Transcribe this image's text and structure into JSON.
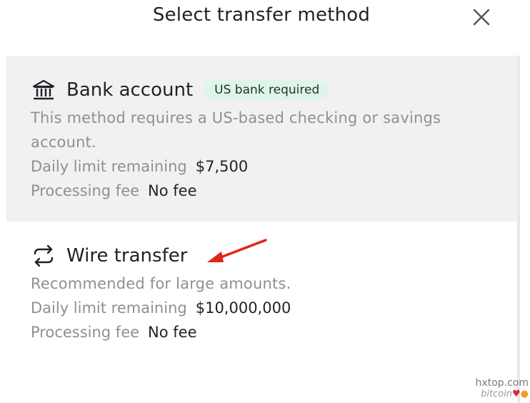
{
  "dialog": {
    "title": "Select transfer method",
    "close_icon": "close-icon"
  },
  "options": [
    {
      "id": "bank",
      "icon": "bank-icon",
      "label": "Bank account",
      "badge": "US bank required",
      "description": "This method requires a US-based checking or savings account.",
      "limit_label": "Daily limit remaining",
      "limit_value": "$7,500",
      "fee_label": "Processing fee",
      "fee_value": "No fee",
      "selected": true
    },
    {
      "id": "wire",
      "icon": "swap-arrows-icon",
      "label": "Wire transfer",
      "description": "Recommended for large amounts.",
      "limit_label": "Daily limit remaining",
      "limit_value": "$10,000,000",
      "fee_label": "Processing fee",
      "fee_value": "No fee",
      "selected": false
    }
  ],
  "annotation": {
    "icon": "red-arrow-icon",
    "color": "#e0241b"
  },
  "watermark": {
    "line1": "hxtop.com",
    "line2": "bitcoin"
  },
  "colors": {
    "selected_bg": "#f1f1f2",
    "badge_bg": "#def5ea",
    "muted_text": "#8c9096"
  }
}
